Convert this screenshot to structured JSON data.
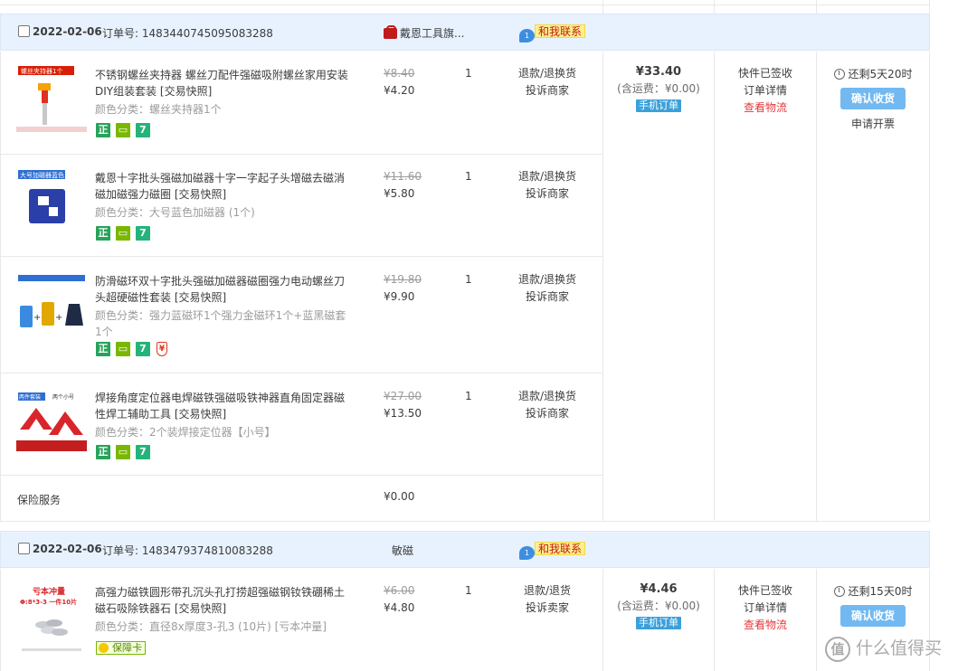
{
  "orders": [
    {
      "date": "2022-02-06",
      "order_no": "订单号: 1483440745095083288",
      "shop": "戴恩工具旗...",
      "contact_label": "和我联系",
      "total": "¥33.40",
      "shipping": "(含运费：¥0.00)",
      "mobile_tag": "手机订单",
      "status": [
        "快件已签收",
        "订单详情",
        "查看物流"
      ],
      "countdown": "还剩5天20时",
      "confirm_label": "确认收货",
      "invoice_label": "申请开票",
      "items": [
        {
          "title": "不锈钢螺丝夹持器 螺丝刀配件强磁吸附螺丝家用安装DIY组装套装 [交易快照]",
          "spec": "颜色分类：螺丝夹持器1个",
          "price_old": "¥8.40",
          "price_new": "¥4.20",
          "qty": "1",
          "after": [
            "退款/退换货",
            "投诉商家"
          ],
          "thumb_label": "螺丝夹持器1个",
          "badges": [
            "正",
            "tv",
            "7"
          ]
        },
        {
          "title": "戴恩十字批头强磁加磁器十字一字起子头增磁去磁消磁加磁强力磁圈 [交易快照]",
          "spec": "颜色分类：大号蓝色加磁器 (1个)",
          "price_old": "¥11.60",
          "price_new": "¥5.80",
          "qty": "1",
          "after": [
            "退款/退换货",
            "投诉商家"
          ],
          "thumb_label": "大号加磁器蓝色",
          "badges": [
            "正",
            "tv",
            "7"
          ]
        },
        {
          "title": "防滑磁环双十字批头强磁加磁器磁圈强力电动螺丝刀头超硬磁性套装 [交易快照]",
          "spec": "颜色分类：强力蓝磁环1个强力金磁环1个+蓝黑磁套1个",
          "price_old": "¥19.80",
          "price_new": "¥9.90",
          "qty": "1",
          "after": [
            "退款/退换货",
            "投诉商家"
          ],
          "badges": [
            "正",
            "tv",
            "7",
            "shield"
          ]
        },
        {
          "title": "焊接角度定位器电焊磁铁强磁吸铁神器直角固定器磁性焊工辅助工具 [交易快照]",
          "spec": "颜色分类：2个装焊接定位器【小号】",
          "price_old": "¥27.00",
          "price_new": "¥13.50",
          "qty": "1",
          "after": [
            "退款/退换货",
            "投诉商家"
          ],
          "thumb_label": "两件套装",
          "thumb_label2": "两个小号",
          "badges": [
            "正",
            "tv",
            "7"
          ]
        }
      ],
      "insurance_label": "保险服务",
      "insurance_price": "¥0.00"
    },
    {
      "date": "2022-02-06",
      "order_no": "订单号: 1483479374810083288",
      "shop": "敏磁",
      "contact_label": "和我联系",
      "total": "¥4.46",
      "shipping": "(含运费：¥0.00)",
      "mobile_tag": "手机订单",
      "status": [
        "快件已签收",
        "订单详情",
        "查看物流"
      ],
      "countdown": "还剩15天0时",
      "confirm_label": "确认收货",
      "items": [
        {
          "title": "高强力磁铁圆形带孔沉头孔打捞超强磁钢钕铁硼稀土磁石吸除铁器石 [交易快照]",
          "spec": "颜色分类：直径8x厚度3-孔3 (10片) [亏本冲量]",
          "price_old": "¥6.00",
          "price_new": "¥4.80",
          "qty": "1",
          "after": [
            "退款/退货",
            "投诉卖家"
          ],
          "thumb_label": "亏本冲量",
          "thumb_label2": "Φ:8*3-3 一件10片",
          "baozhang": "保障卡"
        }
      ]
    }
  ],
  "watermark": "什么值得买",
  "watermark_logo": "值",
  "icons": {
    "checkbox": "checkbox-icon",
    "shop": "shop-bag-icon",
    "contact": "chat-bubble-icon",
    "clock": "clock-icon"
  },
  "colors": {
    "header_bg": "#e8f2ff",
    "button": "#73b9f1",
    "link_red": "#e4393c",
    "mobile_tag": "#3aa0da"
  }
}
